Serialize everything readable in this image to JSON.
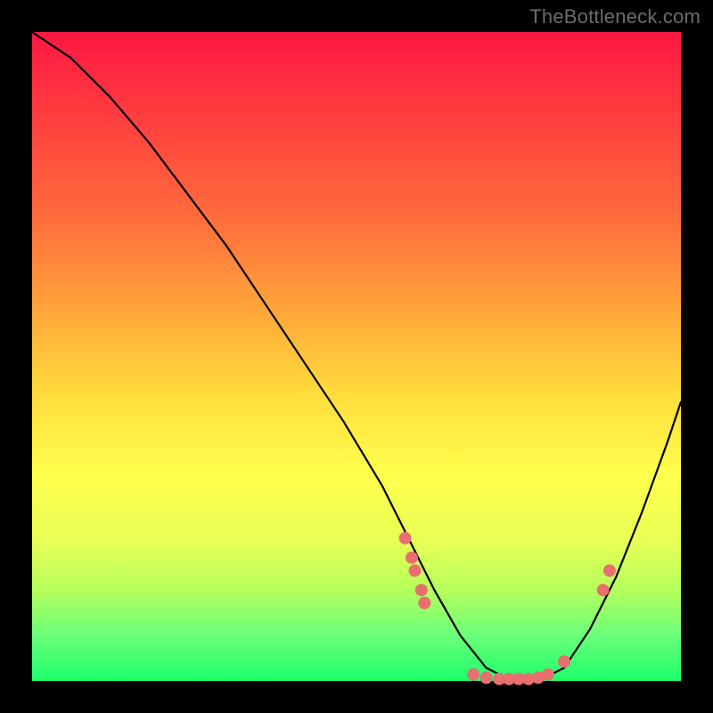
{
  "watermark": "TheBottleneck.com",
  "chart_data": {
    "type": "line",
    "title": "",
    "xlabel": "",
    "ylabel": "",
    "xlim": [
      0,
      100
    ],
    "ylim": [
      0,
      100
    ],
    "series": [
      {
        "name": "curve",
        "x": [
          0,
          6,
          12,
          18,
          24,
          30,
          36,
          42,
          48,
          54,
          58,
          62,
          66,
          70,
          74,
          78,
          82,
          86,
          90,
          94,
          98,
          100
        ],
        "y": [
          100,
          96,
          90,
          83,
          75,
          67,
          58,
          49,
          40,
          30,
          22,
          14,
          7,
          2,
          0,
          0,
          2,
          8,
          16,
          26,
          37,
          43
        ]
      }
    ],
    "markers": [
      {
        "x": 57.5,
        "y": 22
      },
      {
        "x": 58.5,
        "y": 19
      },
      {
        "x": 59.0,
        "y": 17
      },
      {
        "x": 60.0,
        "y": 14
      },
      {
        "x": 60.5,
        "y": 12
      },
      {
        "x": 68.0,
        "y": 1
      },
      {
        "x": 70.0,
        "y": 0.5
      },
      {
        "x": 72.0,
        "y": 0.3
      },
      {
        "x": 73.5,
        "y": 0.3
      },
      {
        "x": 75.0,
        "y": 0.3
      },
      {
        "x": 76.5,
        "y": 0.3
      },
      {
        "x": 78.0,
        "y": 0.5
      },
      {
        "x": 79.5,
        "y": 1
      },
      {
        "x": 82.0,
        "y": 3
      },
      {
        "x": 88.0,
        "y": 14
      },
      {
        "x": 89.0,
        "y": 17
      }
    ],
    "gradient_stops": [
      {
        "pos": 0.0,
        "color": "#ff1744"
      },
      {
        "pos": 0.28,
        "color": "#ff6a3d"
      },
      {
        "pos": 0.55,
        "color": "#ffd93b"
      },
      {
        "pos": 0.78,
        "color": "#eaff55"
      },
      {
        "pos": 1.0,
        "color": "#1cff6b"
      }
    ]
  }
}
